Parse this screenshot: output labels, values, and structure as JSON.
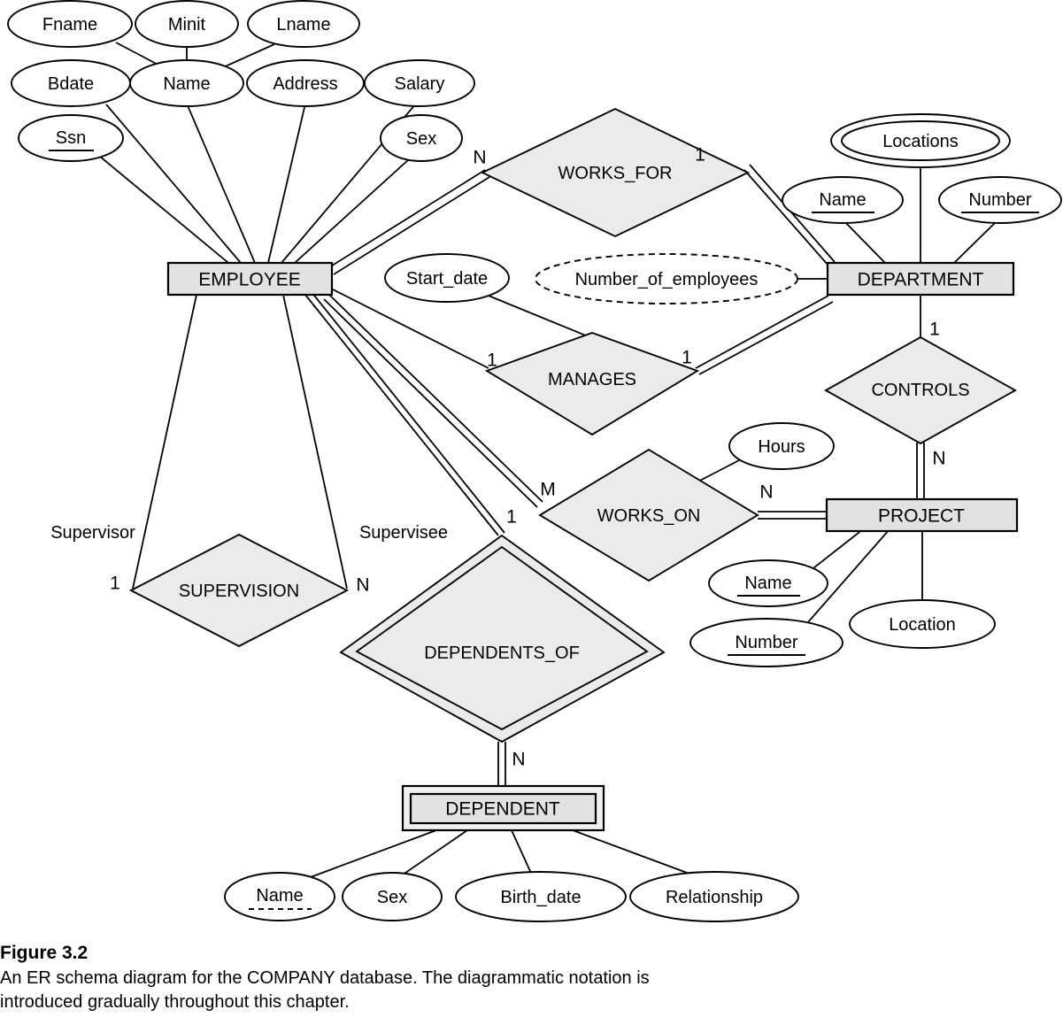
{
  "figure": {
    "title": "Figure 3.2",
    "description": "An ER schema diagram for the COMPANY database. The diagrammatic notation is introduced gradually throughout this chapter."
  },
  "diagram": {
    "type": "er-schema",
    "database_name": "COMPANY",
    "entities": [
      {
        "id": "employee",
        "label": "EMPLOYEE",
        "weak": false
      },
      {
        "id": "department",
        "label": "DEPARTMENT",
        "weak": false
      },
      {
        "id": "project",
        "label": "PROJECT",
        "weak": false
      },
      {
        "id": "dependent",
        "label": "DEPENDENT",
        "weak": true
      }
    ],
    "relationships": [
      {
        "id": "works_for",
        "label": "WORKS_FOR",
        "identifying": false
      },
      {
        "id": "manages",
        "label": "MANAGES",
        "identifying": false
      },
      {
        "id": "works_on",
        "label": "WORKS_ON",
        "identifying": false
      },
      {
        "id": "controls",
        "label": "CONTROLS",
        "identifying": false
      },
      {
        "id": "supervision",
        "label": "SUPERVISION",
        "identifying": false
      },
      {
        "id": "dependents_of",
        "label": "DEPENDENTS_OF",
        "identifying": true
      }
    ],
    "attributes": {
      "employee": [
        {
          "label": "Fname",
          "kind": "simple"
        },
        {
          "label": "Minit",
          "kind": "simple"
        },
        {
          "label": "Lname",
          "kind": "simple"
        },
        {
          "label": "Bdate",
          "kind": "simple"
        },
        {
          "label": "Name",
          "kind": "composite"
        },
        {
          "label": "Address",
          "kind": "simple"
        },
        {
          "label": "Salary",
          "kind": "simple"
        },
        {
          "label": "Ssn",
          "kind": "key"
        },
        {
          "label": "Sex",
          "kind": "simple"
        }
      ],
      "department": [
        {
          "label": "Locations",
          "kind": "multivalued"
        },
        {
          "label": "Name",
          "kind": "key"
        },
        {
          "label": "Number",
          "kind": "key"
        },
        {
          "label": "Number_of_employees",
          "kind": "derived"
        }
      ],
      "project": [
        {
          "label": "Name",
          "kind": "key"
        },
        {
          "label": "Number",
          "kind": "key"
        },
        {
          "label": "Location",
          "kind": "simple"
        }
      ],
      "dependent": [
        {
          "label": "Name",
          "kind": "partial-key"
        },
        {
          "label": "Sex",
          "kind": "simple"
        },
        {
          "label": "Birth_date",
          "kind": "simple"
        },
        {
          "label": "Relationship",
          "kind": "simple"
        }
      ],
      "manages": [
        {
          "label": "Start_date",
          "kind": "simple"
        }
      ],
      "works_on": [
        {
          "label": "Hours",
          "kind": "simple"
        }
      ]
    },
    "cardinalities": {
      "works_for_employee": "N",
      "works_for_department": "1",
      "manages_employee": "1",
      "manages_department": "1",
      "works_on_employee": "M",
      "works_on_project": "N",
      "controls_department": "1",
      "controls_project": "N",
      "supervision_supervisor": "1",
      "supervision_supervisee": "N",
      "dependents_of_employee": "1",
      "dependents_of_dependent": "N"
    },
    "roles": {
      "supervisor": "Supervisor",
      "supervisee": "Supervisee"
    },
    "colors": {
      "entity_fill": "#e2e2e2",
      "relationship_fill": "#ebebeb",
      "attribute_fill": "#ffffff",
      "stroke": "#000000",
      "background": "#ffffff"
    }
  }
}
